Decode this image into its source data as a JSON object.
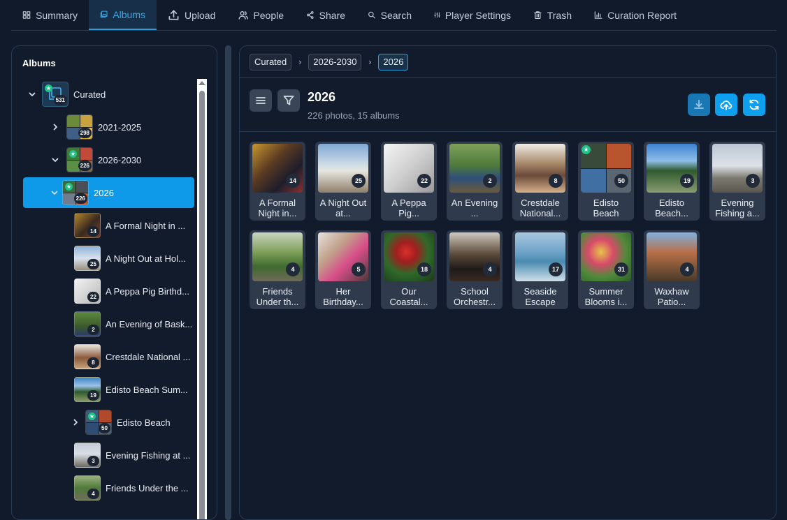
{
  "nav": [
    {
      "label": "Summary",
      "icon": "dashboard-icon"
    },
    {
      "label": "Albums",
      "icon": "albums-icon",
      "active": true
    },
    {
      "label": "Upload",
      "icon": "upload-icon"
    },
    {
      "label": "People",
      "icon": "people-icon"
    },
    {
      "label": "Share",
      "icon": "share-icon"
    },
    {
      "label": "Search",
      "icon": "search-icon"
    },
    {
      "label": "Player Settings",
      "icon": "sliders-icon"
    },
    {
      "label": "Trash",
      "icon": "trash-icon"
    },
    {
      "label": "Curation Report",
      "icon": "bar-chart-icon"
    }
  ],
  "sidebar": {
    "title": "Albums",
    "items": [
      {
        "label": "Curated",
        "count": "531",
        "expanded": true,
        "starred": true
      },
      {
        "label": "2021-2025",
        "count": "298",
        "expanded": false
      },
      {
        "label": "2026-2030",
        "count": "226",
        "expanded": true,
        "starred": true
      },
      {
        "label": "2026",
        "count": "226",
        "expanded": true,
        "starred": true,
        "selected": true
      },
      {
        "label": "A Formal Night in ...",
        "count": "14"
      },
      {
        "label": "A Night Out at Hol...",
        "count": "25"
      },
      {
        "label": "A Peppa Pig Birthd...",
        "count": "22"
      },
      {
        "label": "An Evening of Bask...",
        "count": "2"
      },
      {
        "label": "Crestdale National ...",
        "count": "8"
      },
      {
        "label": "Edisto Beach Sum...",
        "count": "19"
      },
      {
        "label": "Edisto Beach",
        "count": "50",
        "expanded": false,
        "starred": true
      },
      {
        "label": "Evening Fishing at ...",
        "count": "3"
      },
      {
        "label": "Friends Under the ...",
        "count": "4"
      }
    ]
  },
  "breadcrumb": [
    "Curated",
    "2026-2030",
    "2026"
  ],
  "album": {
    "title": "2026",
    "subtitle": "226 photos, 15 albums"
  },
  "cards": [
    {
      "title": "A Formal Night in...",
      "count": "14"
    },
    {
      "title": "A Night Out at...",
      "count": "25"
    },
    {
      "title": "A Peppa Pig...",
      "count": "22"
    },
    {
      "title": "An Evening ...",
      "count": "2"
    },
    {
      "title": "Crestdale National...",
      "count": "8"
    },
    {
      "title": "Edisto Beach",
      "count": "50",
      "starred": true
    },
    {
      "title": "Edisto Beach...",
      "count": "19"
    },
    {
      "title": "Evening Fishing a...",
      "count": "3"
    },
    {
      "title": "Friends Under th...",
      "count": "4"
    },
    {
      "title": "Her Birthday...",
      "count": "5"
    },
    {
      "title": "Our Coastal...",
      "count": "18"
    },
    {
      "title": "School Orchestr...",
      "count": "4"
    },
    {
      "title": "Seaside Escape",
      "count": "17"
    },
    {
      "title": "Summer Blooms i...",
      "count": "31"
    },
    {
      "title": "Waxhaw Patio...",
      "count": "4"
    }
  ],
  "actions": [
    {
      "icon": "download-icon"
    },
    {
      "icon": "cloud-upload-icon"
    },
    {
      "icon": "refresh-icon"
    }
  ],
  "colors": {
    "accent": "#0ea0ee",
    "background": "#111a2b",
    "star_badge": "#22c08b"
  }
}
